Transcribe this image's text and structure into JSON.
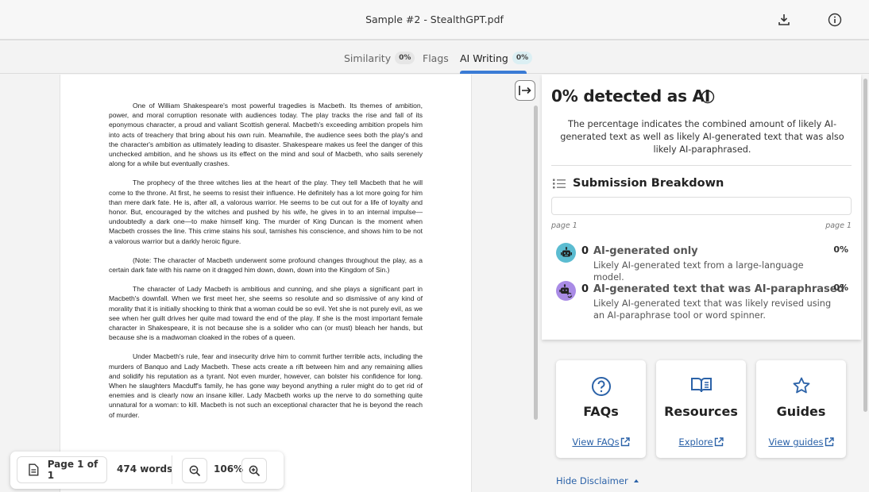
{
  "header": {
    "title": "Sample #2 - StealthGPT.pdf",
    "download_icon": "download-icon",
    "info_icon": "info-icon"
  },
  "tabs": [
    {
      "label": "Similarity",
      "badge": "0%",
      "active": false
    },
    {
      "label": "Flags",
      "badge": null,
      "active": false
    },
    {
      "label": "AI Writing",
      "badge": "0%",
      "active": true
    }
  ],
  "document": {
    "paragraphs": [
      "One of William Shakespeare's most powerful tragedies is Macbeth. Its themes of ambition, power, and moral corruption resonate with audiences today. The play tracks the rise and fall of its eponymous character, a proud and valiant Scottish general. Macbeth's exceeding ambition propels him into acts of treachery that bring about his own ruin. Meanwhile, the audience sees both the play's and the character's ambition as ultimately leading to disaster. Shakespeare makes us feel the danger of this unchecked ambition, and he shows us its effect on the mind and soul of Macbeth, who sails serenely along for a while but eventually crashes.",
      "The prophecy of the three witches lies at the heart of the play. They tell Macbeth that he will come to the throne. At first, he seems to resist their influence. He definitely has a lot more going for him than mere dark fate. He is, after all, a valorous warrior. He seems to be cut out for a life of loyalty and honor. But, encouraged by the witches and pushed by his wife, he gives in to an internal impulse—undoubtedly a dark one—to make himself king. The murder of King Duncan is the moment when Macbeth crosses the line. This crime stains his soul, tarnishes his conscience, and shows him to be not a valorous warrior but a darkly heroic figure.",
      "(Note: The character of Macbeth underwent some profound changes throughout the play, as a certain dark fate with his name on it dragged him down, down, down into the Kingdom of Sin.)",
      "The character of Lady Macbeth is ambitious and cunning, and she plays a significant part in Macbeth's downfall. When we first meet her, she seems so resolute and so dismissive of any kind of morality that it is initially shocking to think that a woman could be so evil. Yet she is not purely evil, as we see when her guilt drives her quite mad toward the end of the play. If she is the most important female character in Shakespeare, it is not because she is a solider who can (or must) bleach her hands, but because she is a madwoman cloaked in the robes of a queen.",
      "Under Macbeth's rule, fear and insecurity drive him to commit further terrible acts, including the murders of Banquo and Lady Macbeth. These acts create a rift between him and any remaining allies and solidify his reputation as a tyrant. Not even murder, however, can bolster his confidence for long. When he slaughters Macduff's family, he has gone way beyond anything a ruler might do to get rid of enemies and is clearly now an insane killer. Lady Macbeth works up the nerve to do something quite unnatural for a woman: to kill. Macbeth is not such an exceptional character that he is beyond the reach of murder."
    ]
  },
  "footer": {
    "page_label": "Page 1 of 1",
    "word_count": "474 words",
    "zoom_level": "106%"
  },
  "ai_panel": {
    "title": "0% detected as AI",
    "description": "The percentage indicates the combined amount of likely AI-generated text as well as likely AI-generated text that was also likely AI-paraphrased.",
    "breakdown_title": "Submission Breakdown",
    "page_start": "page 1",
    "page_end": "page 1",
    "categories": [
      {
        "count": "0",
        "name": "AI-generated only",
        "description": "Likely AI-generated text from a large-language model.",
        "percent": "0%",
        "color": "#5bbcd1"
      },
      {
        "count": "0",
        "name": "AI-generated text that was AI-paraphrased",
        "description": "Likely AI-generated text that was likely revised using an AI-paraphrase tool or word spinner.",
        "percent": "0%",
        "color": "#a98be6"
      }
    ]
  },
  "resources": [
    {
      "icon": "question-circle-icon",
      "title": "FAQs",
      "link": "View FAQs"
    },
    {
      "icon": "book-icon",
      "title": "Resources",
      "link": "Explore"
    },
    {
      "icon": "star-icon",
      "title": "Guides",
      "link": "View guides"
    }
  ],
  "disclaimer_label": "Hide Disclaimer",
  "colors": {
    "accent": "#3a7bd5",
    "link": "#2b62a8"
  }
}
